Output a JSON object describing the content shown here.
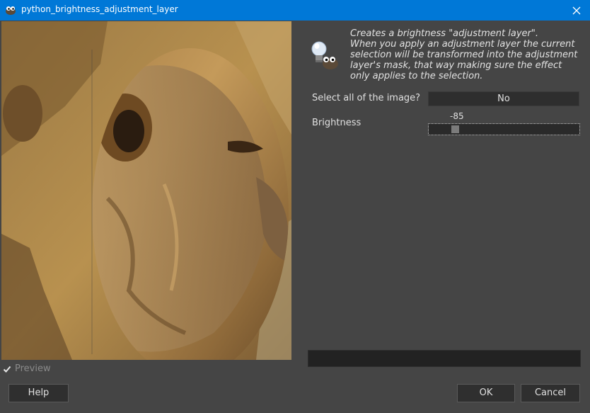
{
  "window": {
    "title": "python_brightness_adjustment_layer"
  },
  "description": [
    "Creates a brightness \"adjustment layer\".",
    "When you apply an adjustment layer the current",
    "selection will be transformed into the adjustment",
    "layer's mask, that way making sure the effect",
    "only applies to the selection."
  ],
  "options": {
    "select_all_label": "Select all of the image?",
    "select_all_value": "No",
    "brightness_label": "Brightness",
    "brightness_value": "-85",
    "brightness_fraction": 0.15
  },
  "preview": {
    "label": "Preview",
    "checked": true
  },
  "buttons": {
    "help": "Help",
    "ok": "OK",
    "cancel": "Cancel"
  },
  "icons": {
    "app": "gimp-icon",
    "close": "close-icon",
    "info": "lightbulb-icon",
    "check": "checkmark-icon"
  },
  "colors": {
    "titlebar": "#0078d7",
    "background": "#454545"
  }
}
